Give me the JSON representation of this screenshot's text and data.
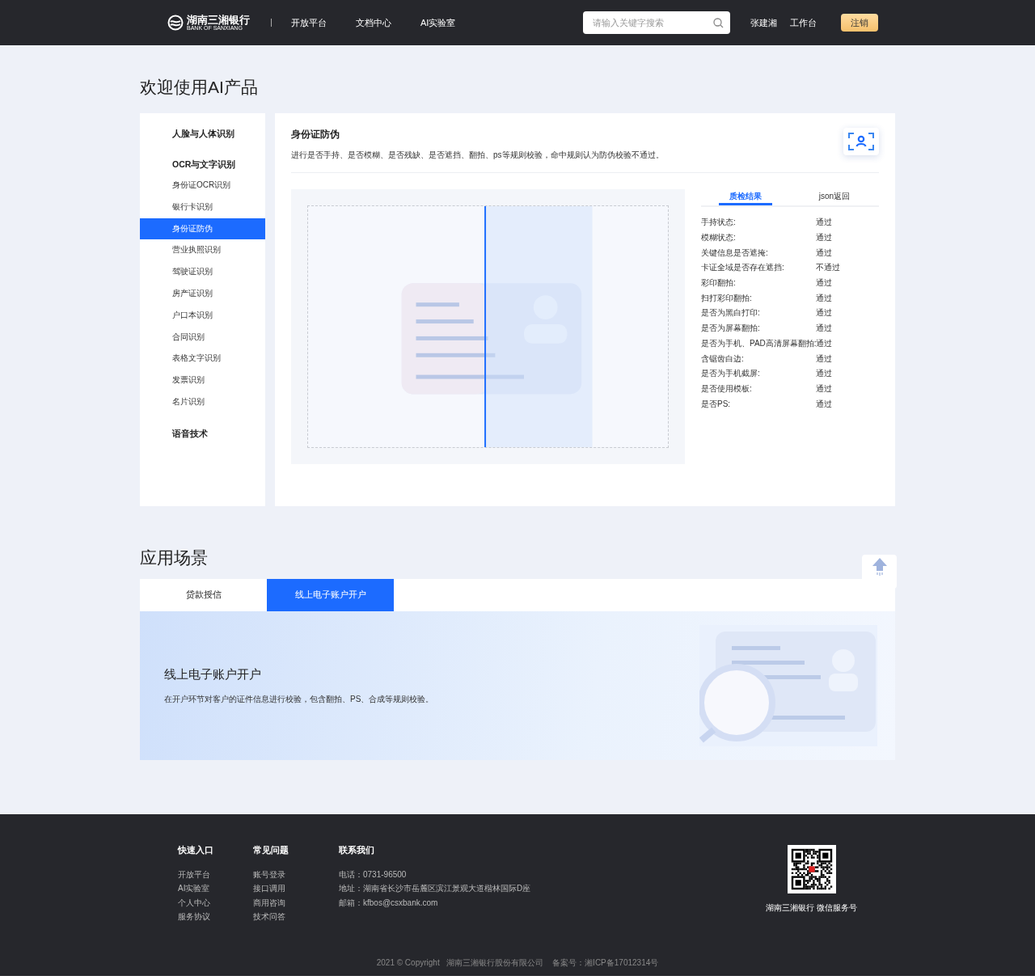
{
  "header": {
    "logo_text": "湖南三湘银行",
    "logo_sub": "BANK OF SANXIANG",
    "nav": [
      {
        "label": "开放平台"
      },
      {
        "label": "文档中心"
      },
      {
        "label": "AI实验室"
      }
    ],
    "search": {
      "placeholder": "请输入关键字搜索"
    },
    "user": "张建湘",
    "workbench": "工作台",
    "logout": "注销"
  },
  "page_title": "欢迎使用AI产品",
  "sidebar": {
    "groups": [
      {
        "label": "人脸与人体识别"
      },
      {
        "label": "OCR与文字识别",
        "items": [
          {
            "label": "身份证OCR识别",
            "selected": false
          },
          {
            "label": "银行卡识别",
            "selected": false
          },
          {
            "label": "身份证防伪",
            "selected": true
          },
          {
            "label": "营业执照识别",
            "selected": false
          },
          {
            "label": "驾驶证识别",
            "selected": false
          },
          {
            "label": "房产证识别",
            "selected": false
          },
          {
            "label": "户口本识别",
            "selected": false
          },
          {
            "label": "合同识别",
            "selected": false
          },
          {
            "label": "表格文字识别",
            "selected": false
          },
          {
            "label": "发票识别",
            "selected": false
          },
          {
            "label": "名片识别",
            "selected": false
          }
        ]
      },
      {
        "label": "语音技术"
      }
    ]
  },
  "product": {
    "title": "身份证防伪",
    "description": "进行是否手持、是否模糊、是否残缺、是否遮挡、翻拍、ps等规则校验，命中规则认为防伪校验不通过。",
    "result_tabs": [
      {
        "label": "质检结果",
        "selected": true
      },
      {
        "label": "json返回",
        "selected": false
      }
    ],
    "results": [
      {
        "label": "手持状态:",
        "value": "通过"
      },
      {
        "label": "模糊状态:",
        "value": "通过"
      },
      {
        "label": "关键信息是否遮掩:",
        "value": "通过"
      },
      {
        "label": "卡证全域是否存在遮挡:",
        "value": "不通过"
      },
      {
        "label": "彩印翻拍:",
        "value": "通过"
      },
      {
        "label": "扫打彩印翻拍:",
        "value": "通过"
      },
      {
        "label": "是否为黑白打印:",
        "value": "通过"
      },
      {
        "label": "是否为屏幕翻拍:",
        "value": "通过"
      },
      {
        "label": "是否为手机、PAD高清屏幕翻拍:",
        "value": "通过"
      },
      {
        "label": "含锯齿白边:",
        "value": "通过"
      },
      {
        "label": "是否为手机截屏:",
        "value": "通过"
      },
      {
        "label": "是否使用模板:",
        "value": "通过"
      },
      {
        "label": "是否PS:",
        "value": "通过"
      }
    ]
  },
  "scenes": {
    "title": "应用场景",
    "tabs": [
      {
        "label": "贷款授信",
        "selected": false
      },
      {
        "label": "线上电子账户开户",
        "selected": true
      }
    ],
    "banner_title": "线上电子账户开户",
    "banner_text": "在开户环节对客户的证件信息进行校验，包含翻拍、PS、合成等规则校验。"
  },
  "footer": {
    "columns": [
      {
        "title": "快速入口",
        "links": [
          "开放平台",
          "AI实验室",
          "个人中心",
          "服务协议"
        ]
      },
      {
        "title": "常见问题",
        "links": [
          "账号登录",
          "接口调用",
          "商用咨询",
          "技术问答"
        ]
      }
    ],
    "contact": {
      "title": "联系我们",
      "lines": [
        "电话：0731-96500",
        "地址：湖南省长沙市岳麓区滨江景观大道楷林国际D座",
        "邮箱：kfbos@csxbank.com"
      ]
    },
    "qr_caption": "湖南三湘银行 微信服务号",
    "copyright": "2021 © Copyright   湖南三湘银行股份有限公司    备案号：湘ICP备17012314号"
  }
}
